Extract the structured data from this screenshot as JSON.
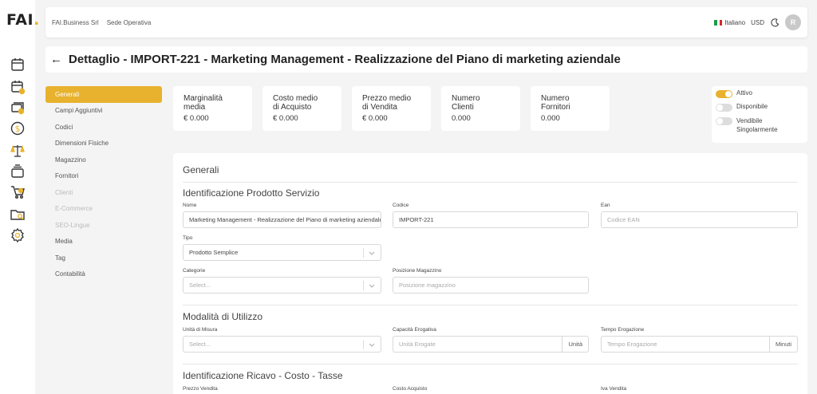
{
  "logo": {
    "text": "FAI",
    "dot": "."
  },
  "colors": {
    "accent": "#e8b22e"
  },
  "rail_icons": [
    "calendar-icon",
    "calendar-add-icon",
    "cash-stack-icon",
    "dollar-coin-icon",
    "scale-icon",
    "layers-icon",
    "cart-icon",
    "folder-search-icon",
    "gear-icon"
  ],
  "topbar": {
    "company": "FAI.Business Srl",
    "site": "Sede Operativa",
    "language": "Italiano",
    "currency": "USD",
    "avatar": "R"
  },
  "title": "Dettaglio - IMPORT-221 - Marketing Management - Realizzazione del Piano di marketing aziendale",
  "nav": [
    {
      "label": "Generali",
      "active": true
    },
    {
      "label": "Campi Aggiuntivi"
    },
    {
      "label": "Codici"
    },
    {
      "label": "Dimensioni Fisiche"
    },
    {
      "label": "Magazzino"
    },
    {
      "label": "Fornitori"
    },
    {
      "label": "Clienti",
      "disabled": true
    },
    {
      "label": "E-Commerce",
      "disabled": true
    },
    {
      "label": "SEO-Lingue",
      "disabled": true
    },
    {
      "label": "Media"
    },
    {
      "label": "Tag"
    },
    {
      "label": "Contabilità"
    }
  ],
  "cards": [
    {
      "line1": "Marginalità",
      "line2": "media",
      "value": "€ 0.000"
    },
    {
      "line1": "Costo medio",
      "line2": "di Acquisto",
      "value": "€ 0.000"
    },
    {
      "line1": "Prezzo medio",
      "line2": "di Vendita",
      "value": "€ 0.000"
    },
    {
      "line1": "Numero",
      "line2": "Clienti",
      "value": "0.000"
    },
    {
      "line1": "Numero",
      "line2": "Fornitori",
      "value": "0.000"
    }
  ],
  "toggles": [
    {
      "line1": "Attivo",
      "line2": "",
      "on": true
    },
    {
      "line1": "Disponibile",
      "line2": "",
      "on": false
    },
    {
      "line1": "Vendibile",
      "line2": "Singolarmente",
      "on": false
    }
  ],
  "panel": {
    "section_title": "Generali",
    "sub1": "Identificazione Prodotto Servizio",
    "nome": {
      "label": "Nome",
      "value": "Marketing Management - Realizzazione del Piano di marketing aziendale"
    },
    "codice": {
      "label": "Codice",
      "value": "IMPORT-221"
    },
    "ean": {
      "label": "Ean",
      "placeholder": "Codice EAN"
    },
    "tipo": {
      "label": "Tipo",
      "value": "Prodotto Semplice"
    },
    "categorie": {
      "label": "Categorie",
      "placeholder": "Select..."
    },
    "posizione": {
      "label": "Posizione Magazzino",
      "placeholder": "Posizione magazzino"
    },
    "sub2": "Modalità di Utilizzo",
    "unita": {
      "label": "Unità di Misura",
      "placeholder": "Select..."
    },
    "capacita": {
      "label": "Capacità Erogativa",
      "placeholder": "Unità Erogate",
      "addon": "Unità"
    },
    "tempo": {
      "label": "Tempo Erogazione",
      "placeholder": "Tempo Erogazione",
      "addon": "Minuti"
    },
    "sub3": "Identificazione Ricavo - Costo - Tasse",
    "prezzo_vendita": {
      "label": "Prezzo Vendita"
    },
    "costo_acquisto": {
      "label": "Costo Acquisto"
    },
    "iva_vendita": {
      "label": "Iva Vendita"
    }
  }
}
